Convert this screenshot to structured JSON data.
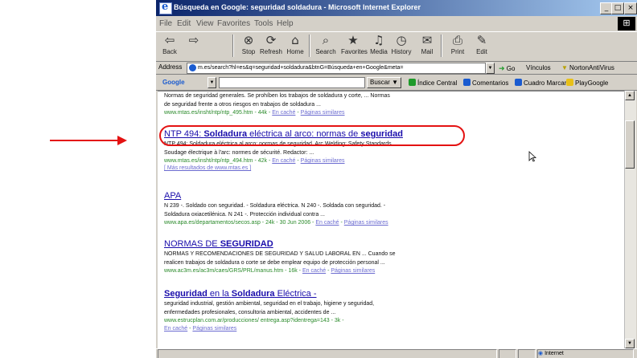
{
  "window": {
    "title": "Búsqueda en Google: seguridad soldadura - Microsoft Internet Explorer",
    "controls": [
      "_",
      "□",
      "×"
    ]
  },
  "menu": [
    "File",
    "Edit",
    "View",
    "Favorites",
    "Tools",
    "Help"
  ],
  "toolbar": {
    "buttons": [
      {
        "label": "Back",
        "icon": "back-arrow-icon",
        "glyph": "⇦"
      },
      {
        "label": "",
        "icon": "forward-arrow-icon",
        "glyph": "⇨"
      },
      {
        "label": "Stop",
        "icon": "stop-icon",
        "glyph": "⊗"
      },
      {
        "label": "Refresh",
        "icon": "refresh-icon",
        "glyph": "⟳"
      },
      {
        "label": "Home",
        "icon": "home-icon",
        "glyph": "⌂"
      },
      {
        "label": "Search",
        "icon": "search-icon",
        "glyph": "⌕"
      },
      {
        "label": "Favorites",
        "icon": "favorites-icon",
        "glyph": "★"
      },
      {
        "label": "Media",
        "icon": "media-icon",
        "glyph": "♫"
      },
      {
        "label": "History",
        "icon": "history-icon",
        "glyph": "◷"
      },
      {
        "label": "Mail",
        "icon": "mail-icon",
        "glyph": "✉"
      },
      {
        "label": "Print",
        "icon": "print-icon",
        "glyph": "⎙"
      },
      {
        "label": "Edit",
        "icon": "edit-icon",
        "glyph": "✎"
      }
    ]
  },
  "address": {
    "label": "Address",
    "value": "m.es/search?hl=es&q=seguridad+soldadura&btnG=Búsqueda+en+Google&meta=",
    "go_label": "Go",
    "vinculos_label": "Vínculos",
    "extra_label": "NortonAntiVirus"
  },
  "google_bar": {
    "brand": "Google",
    "search_button": "Buscar",
    "items": [
      "Índice Central",
      "Comentarios",
      "Cuadro Marcar",
      "PlayGoogle"
    ],
    "colors": {
      "green": "#1f9a2a",
      "blue": "#1a5bd0",
      "yellow": "#e8c018"
    }
  },
  "results": [
    {
      "snippet": [
        "Normas de seguridad generales. Se prohíben los trabajos de soldadura y corte, ... Normas",
        "de seguridad frente a otros riesgos en trabajos de soldadura ..."
      ],
      "url": "www.mtas.es/insht/ntp/ntp_495.htm - 44k -",
      "cache": "En caché",
      "similar": "Páginas similares"
    },
    {
      "title_parts": [
        "NTP 494: ",
        "Soldadura",
        " eléctrica al arco: normas de ",
        "seguridad"
      ],
      "snippet": [
        "NTP 494: Soldadura eléctrica al arco: normas de seguridad. Arc Welding: Safety Standards",
        "Soudage électrique à l'arc: normes de sécurité. Redactor: ..."
      ],
      "url": "www.mtas.es/insht/ntp/ntp_494.htm - 42k -",
      "cache": "En caché",
      "similar": "Páginas similares",
      "more": "[ Más resultados de www.mtas.es ]"
    },
    {
      "title": "APA",
      "snippet": [
        "N 239 -. Soldado con seguridad. - Soldadura eléctrica. N 240 -. Soldada con seguridad. -",
        "Soldadura oxiacetilénica. N 241 -. Protección individual contra ..."
      ],
      "url": "www.apa.es/departamentos/secos.asp - 24k - 30 Jun 2006 -",
      "cache": "En caché",
      "similar": "Páginas similares"
    },
    {
      "title_parts": [
        "NORMAS DE ",
        "SEGURIDAD"
      ],
      "snippet": [
        "NORMAS Y RECOMENDACIONES DE SEGURIDAD Y SALUD LABORAL EN ... Cuando se",
        "realicen trabajos de soldadura o corte se debe emplear equipo de protección personal ..."
      ],
      "url": "www.ac3m.es/ac3m/caes/GRS/PRL/manus.htm - 16k -",
      "cache": "En caché",
      "similar": "Páginas similares"
    },
    {
      "title_parts": [
        "Seguridad",
        " en la ",
        "Soldadura",
        " Eléctrica -"
      ],
      "snippet": [
        "seguridad industrial, gestión ambiental, seguridad en el trabajo, higiene y seguridad,",
        "enfermedades profesionales, consultoria ambiental, accidentes de ..."
      ],
      "url": "www.estrucplan.com.ar/producciones/ entrega.asp?identrega=143 - 3k -",
      "cache": "En caché",
      "similar": "Páginas similares"
    }
  ],
  "status": {
    "zone": "Internet"
  },
  "annotation": {
    "color": "#e41212"
  }
}
